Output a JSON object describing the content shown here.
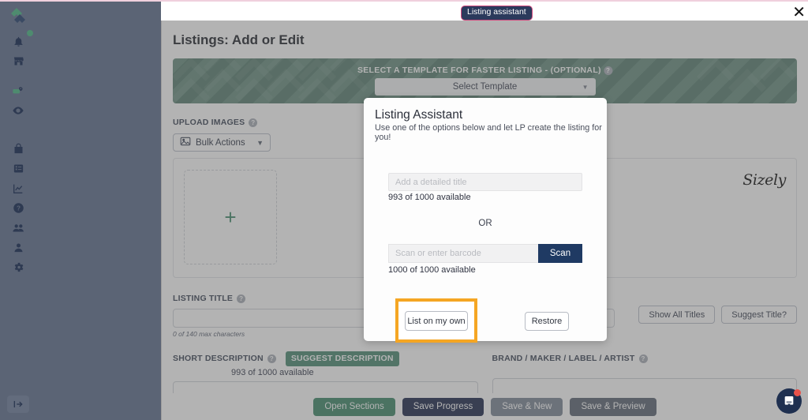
{
  "topbar": {
    "badge_label": "Listing assistant",
    "close_icon": "close-icon"
  },
  "sidebar": {
    "logo_icon": "app-logo-icon",
    "items": [
      {
        "icon": "bell-icon",
        "name": "notifications"
      },
      {
        "icon": "store-icon",
        "name": "store"
      },
      {
        "icon": "tag-icon",
        "name": "pricing"
      },
      {
        "icon": "eye-icon",
        "name": "watch"
      },
      {
        "icon": "bag-icon",
        "name": "orders"
      },
      {
        "icon": "list-icon",
        "name": "listings"
      },
      {
        "icon": "chart-icon",
        "name": "analytics"
      },
      {
        "icon": "help-icon",
        "name": "help"
      },
      {
        "icon": "users-icon",
        "name": "team"
      },
      {
        "icon": "person-icon",
        "name": "account"
      },
      {
        "icon": "gear-icon",
        "name": "settings"
      }
    ],
    "collapse_icon": "collapse-panel-icon"
  },
  "page": {
    "title": "Listings: Add or Edit",
    "template_banner": {
      "label": "SELECT A TEMPLATE FOR FASTER LISTING - (OPTIONAL)",
      "help_icon": "help-icon",
      "select_value": "Select Template",
      "caret_icon": "chevron-down-icon"
    },
    "upload": {
      "label": "UPLOAD IMAGES",
      "help_icon": "help-icon",
      "bulk_actions_label": "Bulk Actions",
      "bulk_icon": "image-icon",
      "caret_icon": "chevron-down-icon",
      "add_image_icon": "plus-icon",
      "watermark": "Sizely"
    },
    "listing_title": {
      "label": "LISTING TITLE",
      "help_icon": "help-icon",
      "value": "",
      "hint": "0 of 140 max characters",
      "show_all_titles_label": "Show All Titles",
      "suggest_title_label": "Suggest Title?"
    },
    "short_description": {
      "label": "SHORT DESCRIPTION",
      "help_icon": "help-icon",
      "suggest_label": "Suggest Description",
      "available": "993 of 1000 available"
    },
    "brand": {
      "label": "BRAND / MAKER / LABEL / ARTIST",
      "help_icon": "help-icon",
      "value": ""
    },
    "footer": {
      "open_sections": "Open Sections",
      "save_progress": "Save Progress",
      "save_new": "Save & New",
      "save_preview": "Save & Preview"
    }
  },
  "modal": {
    "title": "Listing Assistant",
    "subtitle": "Use one of the options below and let LP create the listing for you!",
    "title_input": {
      "value": "",
      "placeholder": "Add a detailed title"
    },
    "title_available": "993 of 1000 available",
    "or_label": "OR",
    "barcode_input": {
      "value": "",
      "placeholder": "Scan or enter barcode"
    },
    "scan_button": "Scan",
    "barcode_available": "1000 of 1000 available",
    "list_on_my_own": "List on my own",
    "restore": "Restore"
  },
  "intercom": {
    "icon": "chat-bubble-icon",
    "badge_icon": "unread-dot"
  },
  "colors": {
    "sidebar": "#5b6475",
    "banner_green": "#5e8677",
    "accent_green": "#3f8a6a",
    "navy": "#1f2a4d",
    "scan_navy": "#1f3a63",
    "highlight_orange": "#f5a623",
    "badge_border_pink": "#d24a7e"
  }
}
